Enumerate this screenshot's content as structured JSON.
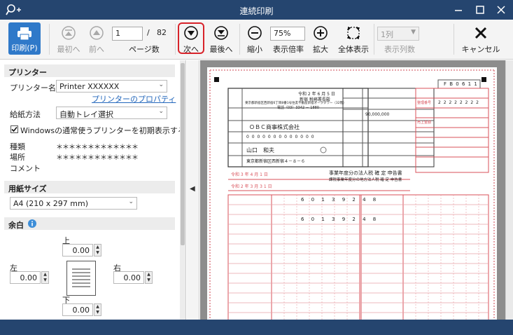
{
  "window": {
    "title": "連続印刷"
  },
  "toolbar": {
    "print_label": "印刷(P)",
    "first_label": "最初へ",
    "prev_label": "前へ",
    "page_current": "1",
    "page_sep": "/",
    "page_total": "82",
    "page_label": "ページ数",
    "next_label": "次へ",
    "last_label": "最後へ",
    "zoom_out_label": "縮小",
    "zoom_value": "75%",
    "zoom_label": "表示倍率",
    "zoom_in_label": "拡大",
    "fit_label": "全体表示",
    "columns_value": "1列",
    "columns_label": "表示列数",
    "cancel_label": "キャンセル"
  },
  "printer_section": {
    "heading": "プリンター",
    "printer_name_label": "プリンター名",
    "printer_name_value": "Printer XXXXXX",
    "properties_link": "プリンターのプロパティ",
    "feed_label": "給紙方法",
    "feed_value": "自動トレイ選択",
    "use_default_label": "Windowsの通常使うプリンターを初期表示する",
    "use_default_checked": true,
    "type_label": "種類",
    "type_value": "＊＊＊＊＊＊＊＊＊＊＊＊＊",
    "location_label": "場所",
    "location_value": "＊＊＊＊＊＊＊＊＊＊＊＊＊",
    "comment_label": "コメント"
  },
  "paper_section": {
    "heading": "用紙サイズ",
    "size_value": "A4 (210 x 297 mm)"
  },
  "margin_section": {
    "heading": "余白",
    "top_label": "上",
    "top_value": "0.00",
    "left_label": "左",
    "left_value": "0.00",
    "right_label": "右",
    "right_value": "0.00",
    "bottom_label": "下",
    "bottom_value": "0.00"
  },
  "document": {
    "form_code": "F B 0 6 1 1",
    "date_line": "令和 2 年 6 月 5 日",
    "office": "新宿 税務署長殿",
    "address": "東京都新宿区西新宿6丁目8番1号住友不動産新宿オークタワー（32階）",
    "phone": "電話（03）3342 － 1880",
    "company": "ＯＢＣ商事株式会社",
    "corp_number": "0 0 0 0 0 0 0 0 0 0 0 0 0",
    "representative": "山口　和夫",
    "rep_address": "東京都新宿区西新宿４－８－６",
    "capital": "90,000,000",
    "fiscal_year_start": "令和 3 年 4 月 1 日",
    "fiscal_year_end": "令和 2 年 3 月 3 1 日",
    "return_title": "事業年度分の法人税 確 定 申告書",
    "return_title2": "課税事業年度分の地方法人税 確 定 申告書",
    "amount_row1": "6 0 1 3 9 2 4 8",
    "amount_row2": "6 0 1 3 9 2 4 8",
    "section_label": "売上金額",
    "office_code_label": "整理番号",
    "office_code": "2 2 2 2 2 2 2 2"
  },
  "colors": {
    "titlebar": "#25456f",
    "accent": "#2f79c9",
    "highlight": "#d8232a",
    "form_red": "#d9505a"
  }
}
